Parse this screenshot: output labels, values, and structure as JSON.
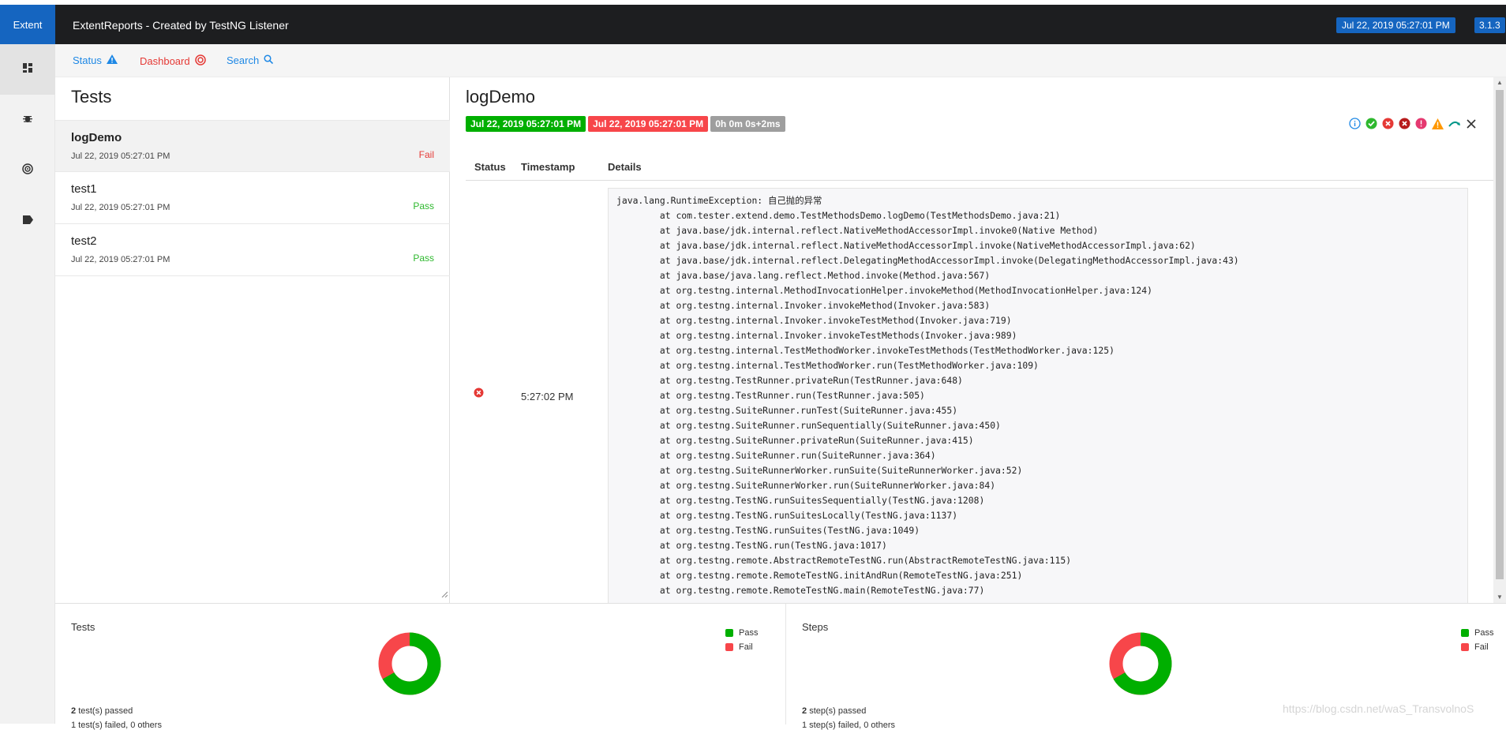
{
  "header": {
    "brand": "Extent",
    "title": "ExtentReports - Created by TestNG Listener",
    "date": "Jul 22, 2019 05:27:01 PM",
    "version": "3.1.3"
  },
  "sidenav": {
    "items": [
      {
        "icon": "dashboard-grid-icon"
      },
      {
        "icon": "bug-icon"
      },
      {
        "icon": "target-icon"
      },
      {
        "icon": "label-icon"
      }
    ]
  },
  "subnav": {
    "status_label": "Status",
    "dashboard_label": "Dashboard",
    "search_label": "Search"
  },
  "tests": {
    "title": "Tests",
    "items": [
      {
        "name": "logDemo",
        "time": "Jul 22, 2019 05:27:01 PM",
        "status": "Fail"
      },
      {
        "name": "test1",
        "time": "Jul 22, 2019 05:27:01 PM",
        "status": "Pass"
      },
      {
        "name": "test2",
        "time": "Jul 22, 2019 05:27:01 PM",
        "status": "Pass"
      }
    ]
  },
  "detail": {
    "title": "logDemo",
    "start_time": "Jul 22, 2019 05:27:01 PM",
    "end_time": "Jul 22, 2019 05:27:01 PM",
    "duration": "0h 0m 0s+2ms",
    "columns": [
      "Status",
      "Timestamp",
      "Details"
    ],
    "log": {
      "status": "fail",
      "timestamp": "5:27:02 PM",
      "details": "java.lang.RuntimeException: 自己抛的异常\n\tat com.tester.extend.demo.TestMethodsDemo.logDemo(TestMethodsDemo.java:21)\n\tat java.base/jdk.internal.reflect.NativeMethodAccessorImpl.invoke0(Native Method)\n\tat java.base/jdk.internal.reflect.NativeMethodAccessorImpl.invoke(NativeMethodAccessorImpl.java:62)\n\tat java.base/jdk.internal.reflect.DelegatingMethodAccessorImpl.invoke(DelegatingMethodAccessorImpl.java:43)\n\tat java.base/java.lang.reflect.Method.invoke(Method.java:567)\n\tat org.testng.internal.MethodInvocationHelper.invokeMethod(MethodInvocationHelper.java:124)\n\tat org.testng.internal.Invoker.invokeMethod(Invoker.java:583)\n\tat org.testng.internal.Invoker.invokeTestMethod(Invoker.java:719)\n\tat org.testng.internal.Invoker.invokeTestMethods(Invoker.java:989)\n\tat org.testng.internal.TestMethodWorker.invokeTestMethods(TestMethodWorker.java:125)\n\tat org.testng.internal.TestMethodWorker.run(TestMethodWorker.java:109)\n\tat org.testng.TestRunner.privateRun(TestRunner.java:648)\n\tat org.testng.TestRunner.run(TestRunner.java:505)\n\tat org.testng.SuiteRunner.runTest(SuiteRunner.java:455)\n\tat org.testng.SuiteRunner.runSequentially(SuiteRunner.java:450)\n\tat org.testng.SuiteRunner.privateRun(SuiteRunner.java:415)\n\tat org.testng.SuiteRunner.run(SuiteRunner.java:364)\n\tat org.testng.SuiteRunnerWorker.runSuite(SuiteRunnerWorker.java:52)\n\tat org.testng.SuiteRunnerWorker.run(SuiteRunnerWorker.java:84)\n\tat org.testng.TestNG.runSuitesSequentially(TestNG.java:1208)\n\tat org.testng.TestNG.runSuitesLocally(TestNG.java:1137)\n\tat org.testng.TestNG.runSuites(TestNG.java:1049)\n\tat org.testng.TestNG.run(TestNG.java:1017)\n\tat org.testng.remote.AbstractRemoteTestNG.run(AbstractRemoteTestNG.java:115)\n\tat org.testng.remote.RemoteTestNG.initAndRun(RemoteTestNG.java:251)\n\tat org.testng.remote.RemoteTestNG.main(RemoteTestNG.java:77)"
    },
    "filter_icons": [
      "info-icon",
      "pass-icon",
      "fail-icon",
      "fatal-icon",
      "error-icon",
      "warning-icon",
      "skip-icon",
      "clear-icon"
    ]
  },
  "dashboard": {
    "tests_card": {
      "title": "Tests",
      "summary_count": "2",
      "summary_text": "test(s) passed",
      "summary_line2": "1 test(s) failed, 0 others",
      "legend": [
        "Pass",
        "Fail"
      ],
      "pass": 2,
      "fail": 1
    },
    "steps_card": {
      "title": "Steps",
      "summary_count": "2",
      "summary_text": "step(s) passed",
      "summary_line2": "1 step(s) failed, 0 others",
      "legend": [
        "Pass",
        "Fail"
      ],
      "pass": 2,
      "fail": 1
    }
  },
  "colors": {
    "pass": "#00af00",
    "fail": "#f7464a",
    "accent": "#1565c0",
    "topbar": "#1d1e20",
    "duration": "#9e9e9e"
  },
  "watermark": "https://blog.csdn.net/waS_TransvolnoS"
}
